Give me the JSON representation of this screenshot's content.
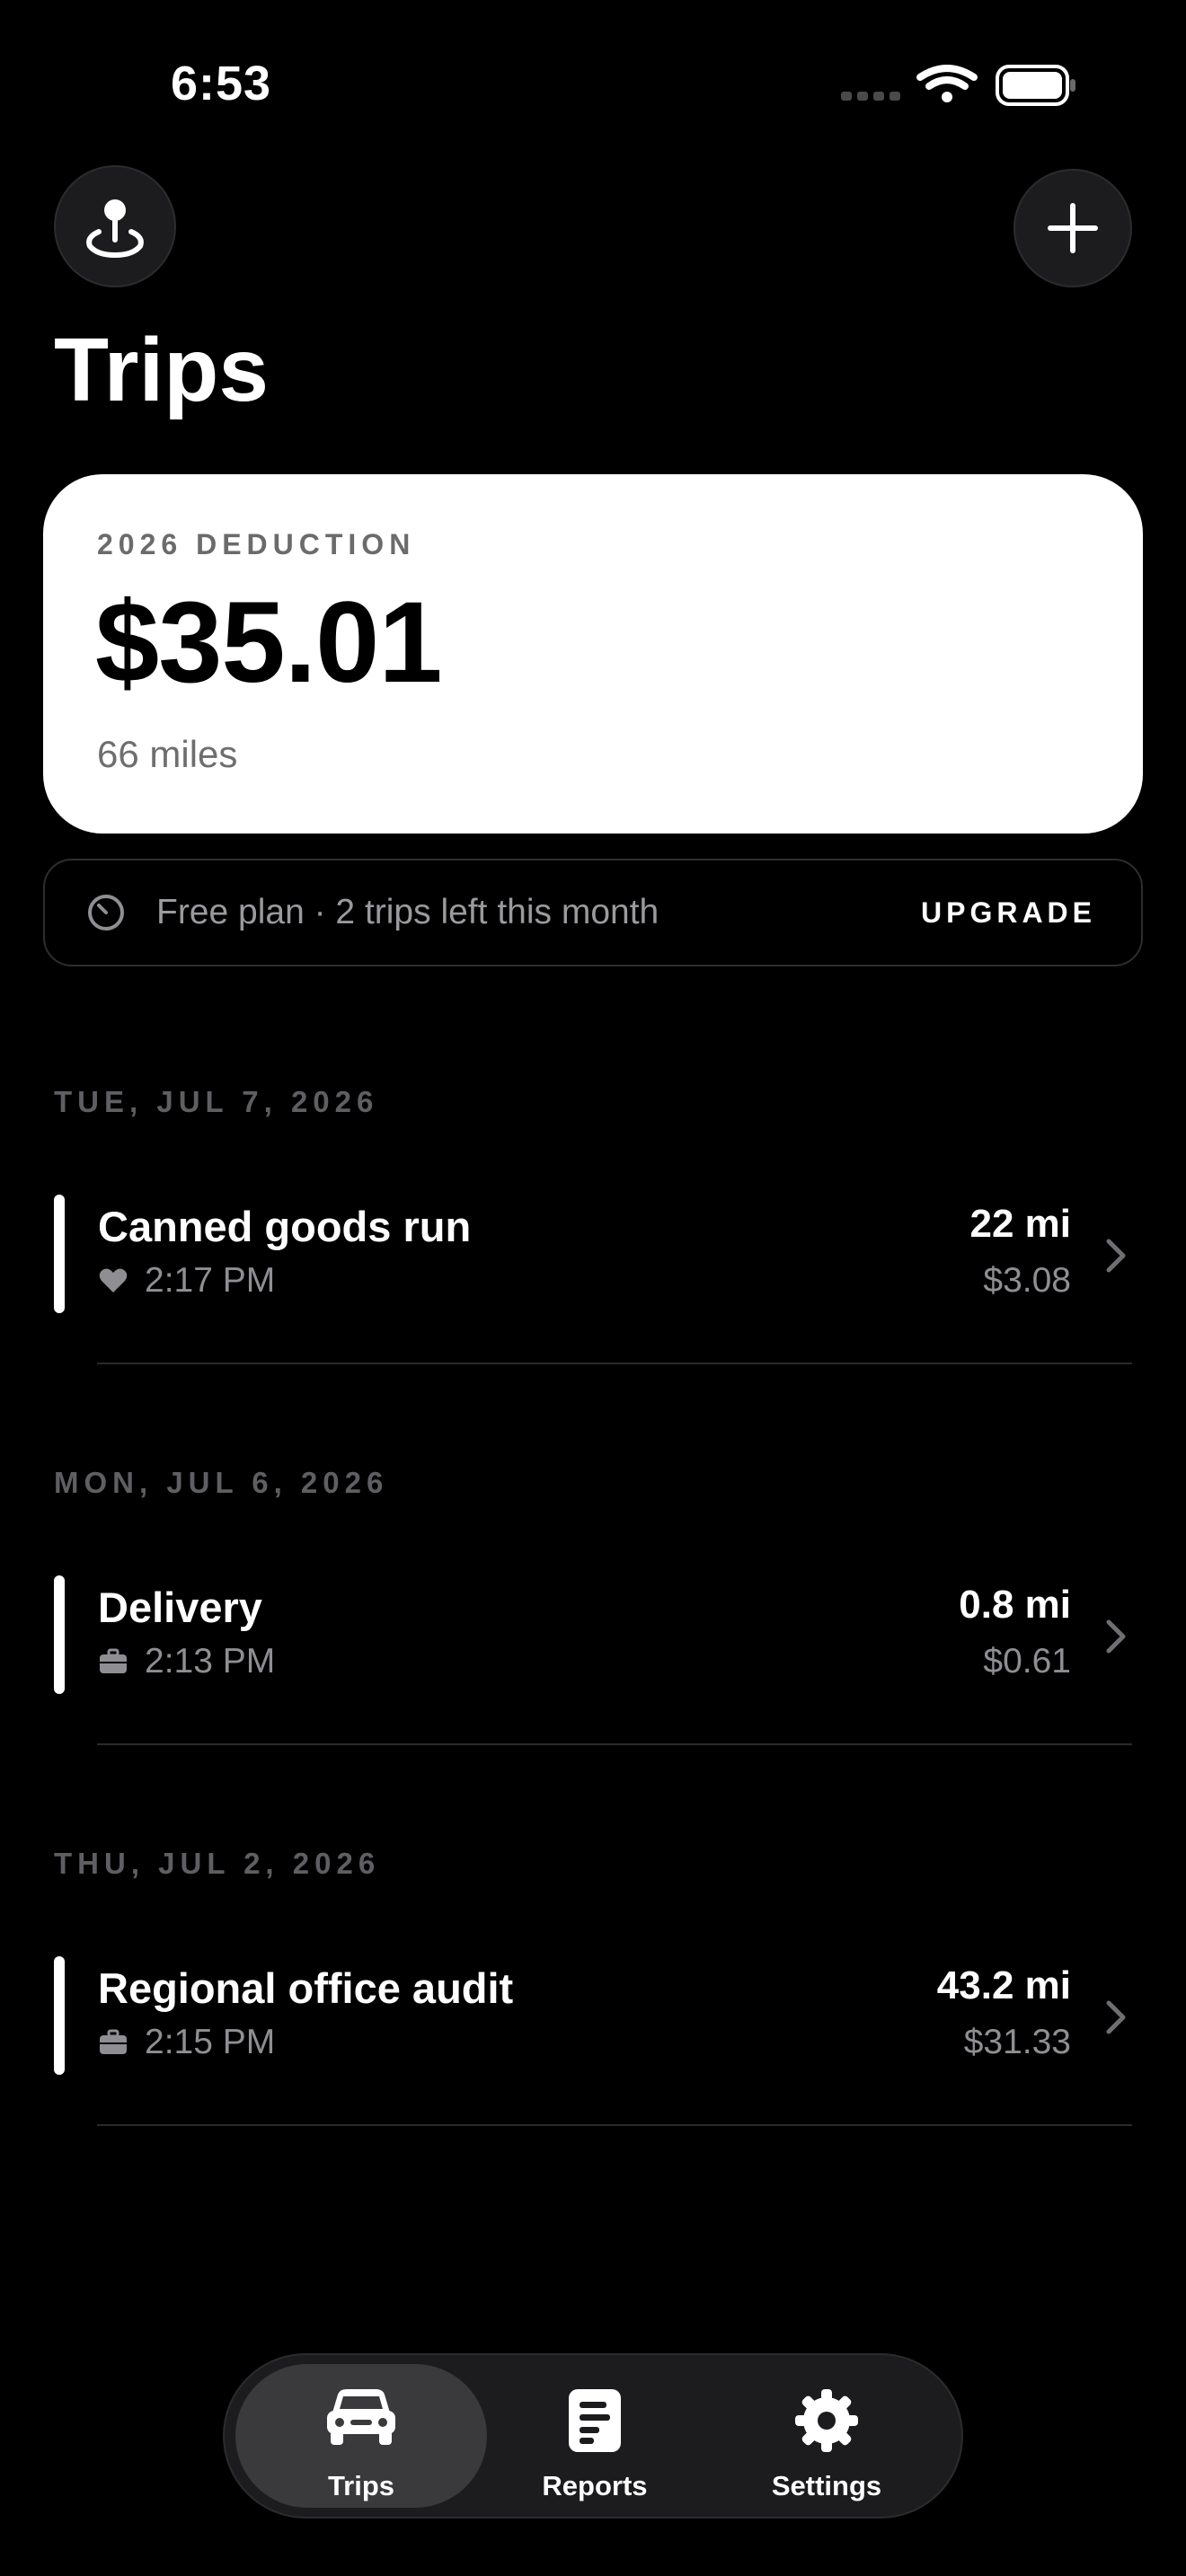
{
  "status": {
    "time": "6:53"
  },
  "header": {
    "title": "Trips",
    "location_icon": "location-pin-icon",
    "add_icon": "plus-icon"
  },
  "summary": {
    "label": "2026 DEDUCTION",
    "amount": "$35.01",
    "miles": "66 miles"
  },
  "plan": {
    "icon": "clock-icon",
    "text": "Free plan · 2 trips left this month",
    "action": "UPGRADE"
  },
  "groups": [
    {
      "date": "TUE, JUL 7, 2026",
      "trips": [
        {
          "title": "Canned goods run",
          "icon": "heart-icon",
          "time": "2:17 PM",
          "miles": "22 mi",
          "amount": "$3.08"
        }
      ]
    },
    {
      "date": "MON, JUL 6, 2026",
      "trips": [
        {
          "title": "Delivery",
          "icon": "briefcase-icon",
          "time": "2:13 PM",
          "miles": "0.8 mi",
          "amount": "$0.61"
        }
      ]
    },
    {
      "date": "THU, JUL 2, 2026",
      "trips": [
        {
          "title": "Regional office audit",
          "icon": "briefcase-icon",
          "time": "2:15 PM",
          "miles": "43.2 mi",
          "amount": "$31.33"
        }
      ]
    }
  ],
  "tabs": [
    {
      "label": "Trips",
      "icon": "car-icon",
      "active": true
    },
    {
      "label": "Reports",
      "icon": "document-icon",
      "active": false
    },
    {
      "label": "Settings",
      "icon": "gear-icon",
      "active": false
    }
  ],
  "colors": {
    "background": "#000000",
    "card": "#ffffff",
    "muted": "#8e8e93",
    "tabbar": "#1c1c1e"
  }
}
